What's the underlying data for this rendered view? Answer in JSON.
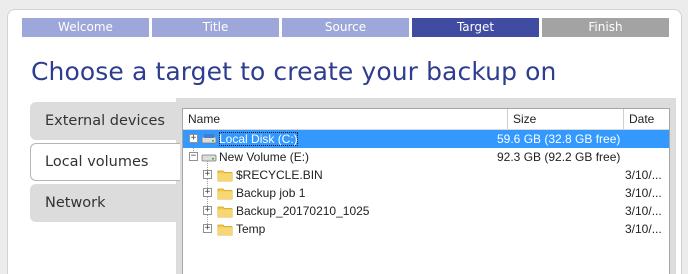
{
  "wizard_steps": [
    {
      "label": "Welcome",
      "state": "done"
    },
    {
      "label": "Title",
      "state": "done"
    },
    {
      "label": "Source",
      "state": "done"
    },
    {
      "label": "Target",
      "state": "current"
    },
    {
      "label": "Finish",
      "state": "pending"
    }
  ],
  "heading": "Choose a target to create your backup on",
  "side_tabs": [
    {
      "label": "External devices",
      "selected": false
    },
    {
      "label": "Local volumes",
      "selected": true
    },
    {
      "label": "Network",
      "selected": false
    }
  ],
  "tree": {
    "columns": {
      "name": "Name",
      "size": "Size",
      "date": "Date"
    },
    "rows": [
      {
        "name": "Local Disk (C:)",
        "size": "59.6 GB (32.8 GB free)",
        "date": "",
        "icon": "drive-icon",
        "expander": "+",
        "selected": true
      },
      {
        "name": "New Volume (E:)",
        "size": "92.3 GB (92.2 GB free)",
        "date": "",
        "icon": "drive-icon",
        "expander": "−",
        "selected": false
      },
      {
        "name": "$RECYCLE.BIN",
        "size": "",
        "date": "3/10/...",
        "icon": "folder-icon",
        "expander": "+",
        "selected": false
      },
      {
        "name": "Backup job 1",
        "size": "",
        "date": "3/10/...",
        "icon": "folder-icon",
        "expander": "+",
        "selected": false
      },
      {
        "name": "Backup_20170210_1025",
        "size": "",
        "date": "3/10/...",
        "icon": "folder-icon",
        "expander": "+",
        "selected": false
      },
      {
        "name": "Temp",
        "size": "",
        "date": "3/10/...",
        "icon": "folder-icon",
        "expander": "+",
        "selected": false
      }
    ]
  },
  "colors": {
    "step_done": "#9da7d9",
    "step_current": "#3f4ca2",
    "step_pending": "#a3a3a3",
    "heading": "#2e3d8f",
    "selection": "#3399ff"
  }
}
